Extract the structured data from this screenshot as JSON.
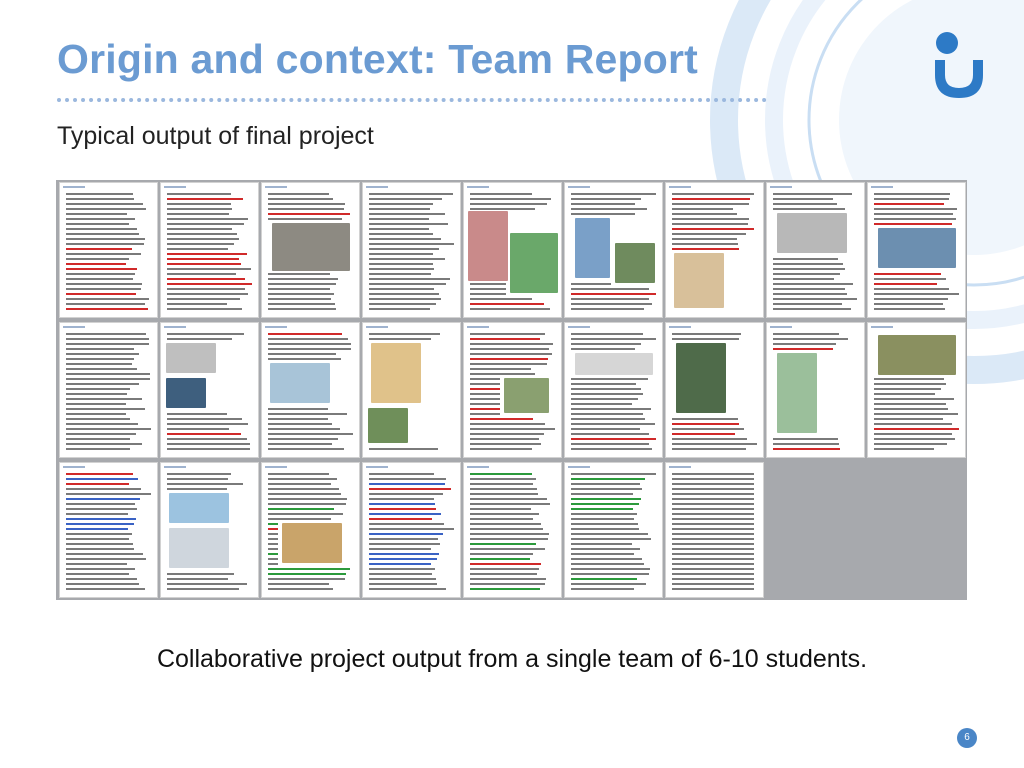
{
  "slide": {
    "title": "Origin and context: Team Report",
    "subtitle": "Typical output of final project",
    "caption": "Collaborative project output from a single team of 6-10 students.",
    "page_number": "6"
  },
  "thumbnails": {
    "rows": 3,
    "columns": 9,
    "count": 25
  },
  "colors": {
    "title": "#6b9bd2",
    "accent": "#4a86c7",
    "thumb_background": "#a7a9ad"
  },
  "icons": {
    "logo": "open-university-logo"
  }
}
